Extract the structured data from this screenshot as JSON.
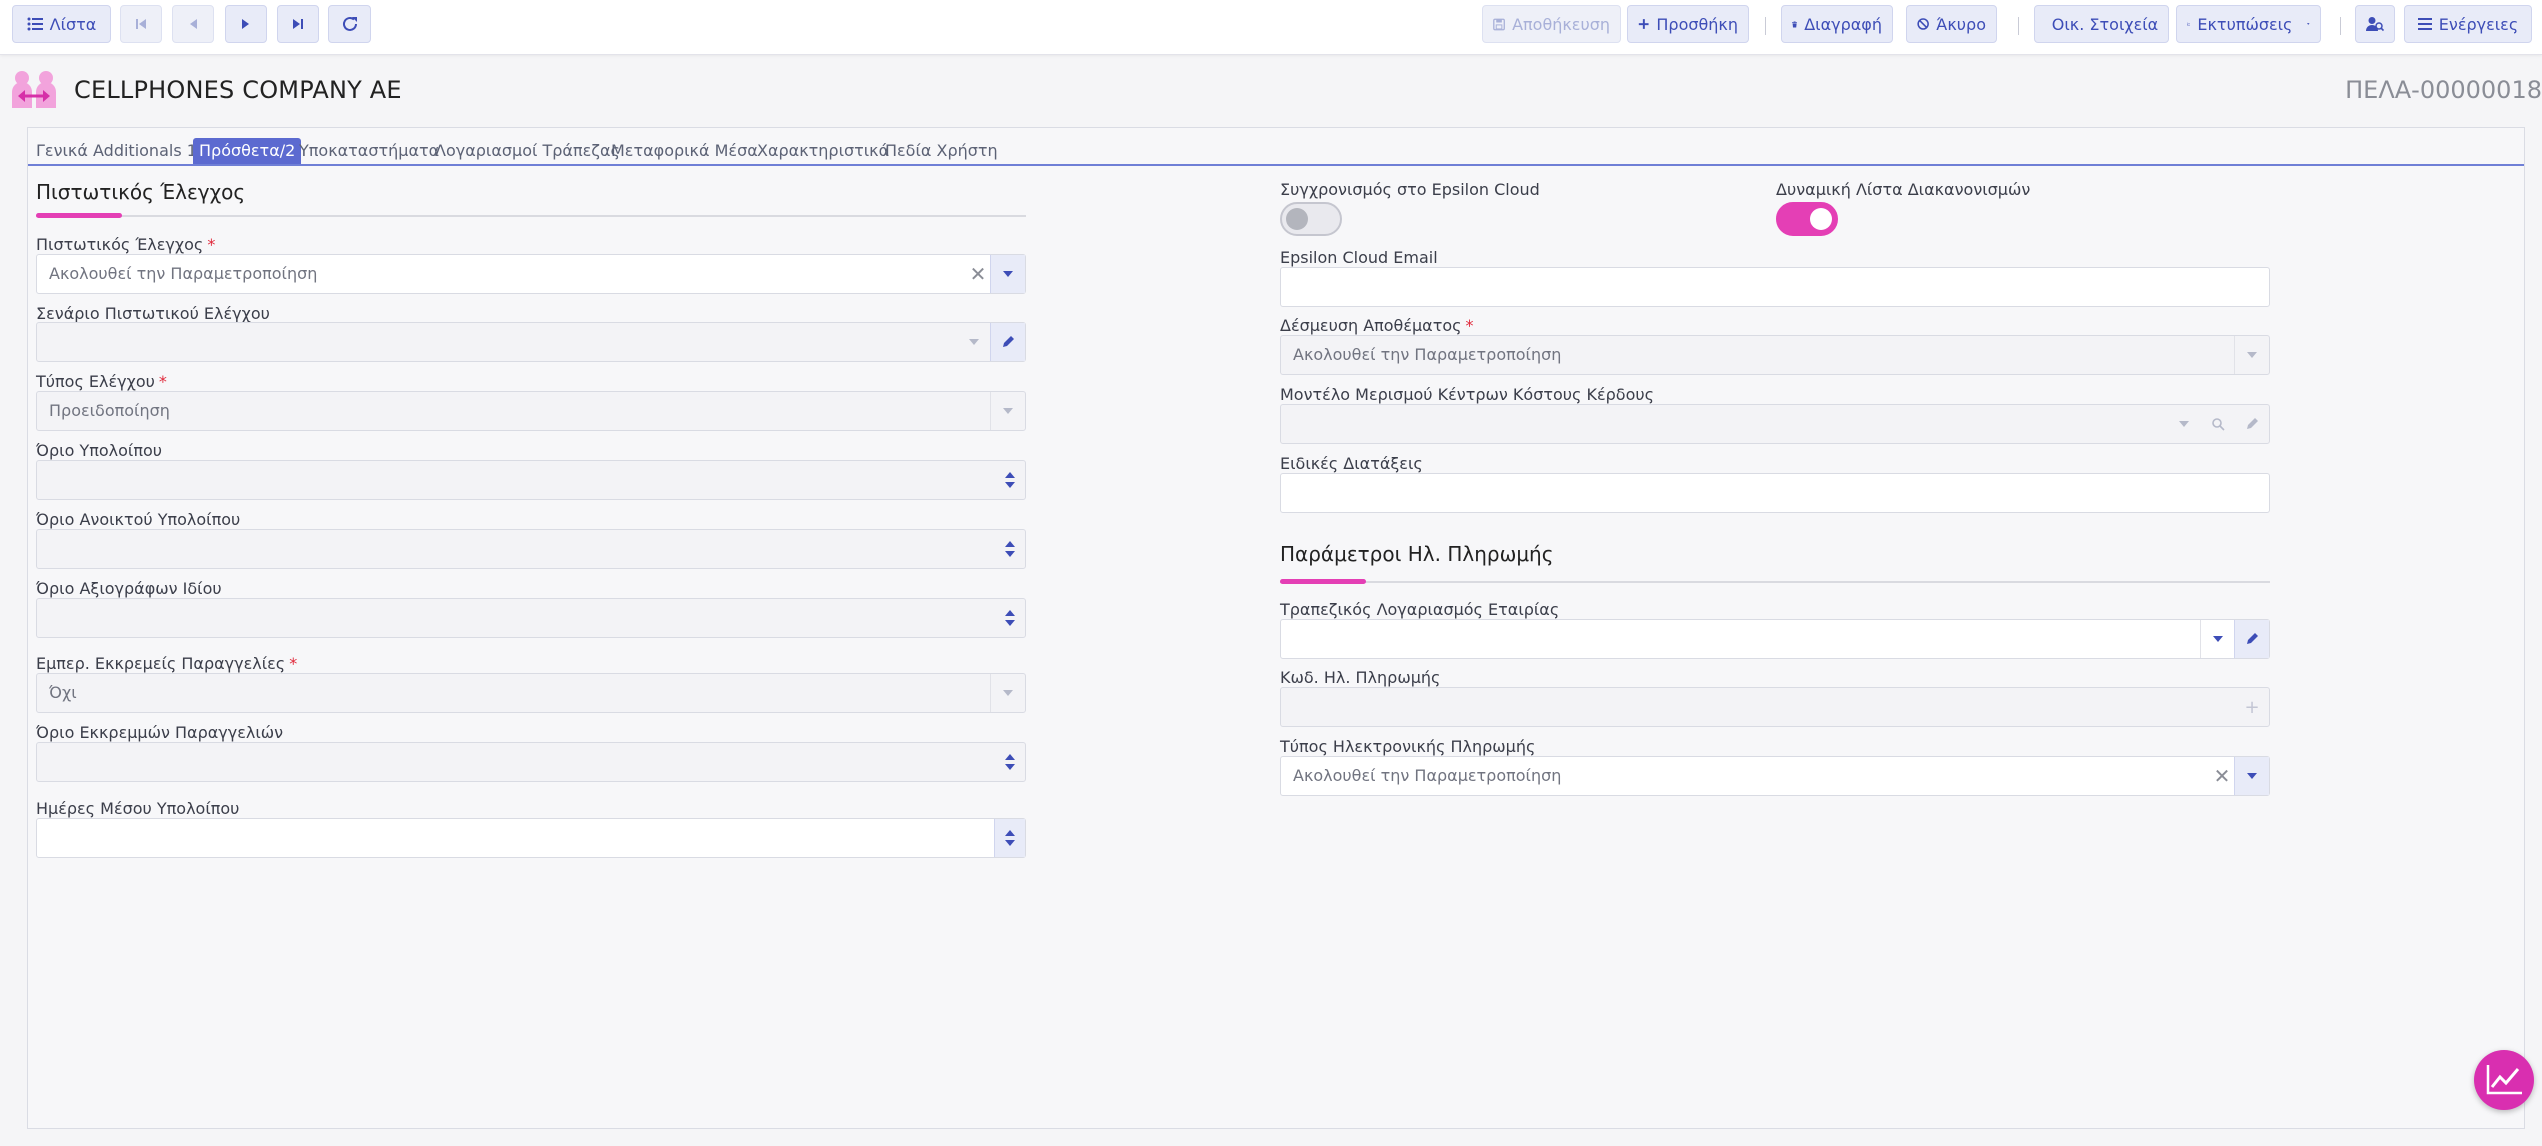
{
  "toolbar": {
    "list_label": "Λίστα",
    "save_label": "Αποθήκευση",
    "add_label": "Προσθήκη",
    "delete_label": "Διαγραφή",
    "cancel_label": "Άκυρο",
    "financial_label": "Οικ. Στοιχεία",
    "prints_label": "Εκτυπώσεις",
    "actions_label": "Ενέργειες"
  },
  "header": {
    "company": "CELLPHONES COMPANY AE",
    "code": "ΠΕΛΑ-00000018"
  },
  "tabs": [
    {
      "label": "Γενικά",
      "active": false
    },
    {
      "label": "Additionals 1",
      "active": false
    },
    {
      "label": "Πρόσθετα/2",
      "active": true
    },
    {
      "label": "Υποκαταστήματα",
      "active": false
    },
    {
      "label": "Λογαριασμοί Τράπεζας",
      "active": false
    },
    {
      "label": "Μεταφορικά Μέσα",
      "active": false
    },
    {
      "label": "Χαρακτηριστικά",
      "active": false
    },
    {
      "label": "Πεδία Χρήστη",
      "active": false
    }
  ],
  "left": {
    "section_title": "Πιστωτικός Έλεγχος",
    "credit_control": {
      "label": "Πιστωτικός Έλεγχος",
      "value": "Ακολουθεί την Παραμετροποίηση"
    },
    "credit_scenario": {
      "label": "Σενάριο Πιστωτικού Ελέγχου",
      "value": ""
    },
    "control_type": {
      "label": "Τύπος Ελέγχου",
      "value": "Προειδοποίηση"
    },
    "balance_limit": {
      "label": "Όριο Υπολοίπου",
      "value": ""
    },
    "open_balance_limit": {
      "label": "Όριο Ανοικτού Υπολοίπου",
      "value": ""
    },
    "own_cheques_limit": {
      "label": "Όριο Αξιογράφων Ιδίου",
      "value": ""
    },
    "pending_orders": {
      "label": "Εμπερ. Εκκρεμείς Παραγγελίες",
      "value": "Όχι"
    },
    "pending_orders_limit": {
      "label": "Όριο Εκκρεμμών Παραγγελιών",
      "value": ""
    },
    "avg_balance_days": {
      "label": "Ημέρες Μέσου Υπολοίπου",
      "value": ""
    }
  },
  "right": {
    "epsilon_sync": {
      "label": "Συγχρονισμός στο Epsilon Cloud",
      "on": false
    },
    "dynamic_list": {
      "label": "Δυναμική Λίστα Διακανονισμών",
      "on": true
    },
    "epsilon_email": {
      "label": "Epsilon Cloud Email",
      "value": ""
    },
    "stock_reservation": {
      "label": "Δέσμευση Αποθέματος",
      "value": "Ακολουθεί την Παραμετροποίηση"
    },
    "cost_center_model": {
      "label": "Μοντέλο Μερισμού Κέντρων Κόστους Κέρδους",
      "value": ""
    },
    "special_instructions": {
      "label": "Ειδικές Διατάξεις",
      "value": ""
    },
    "payment_section_title": "Παράμετροι Ηλ. Πληρωμής",
    "company_bank_account": {
      "label": "Τραπεζικός Λογαριασμός Εταιρίας",
      "value": ""
    },
    "epayment_code": {
      "label": "Κωδ. Ηλ. Πληρωμής",
      "value": ""
    },
    "epayment_type": {
      "label": "Τύπος Ηλεκτρονικής Πληρωμής",
      "value": "Ακολουθεί την Παραμετροποίηση"
    }
  },
  "colors": {
    "accent": "#e43fb5",
    "primary": "#5c6ad0",
    "button_bg": "#e8ebf8"
  }
}
